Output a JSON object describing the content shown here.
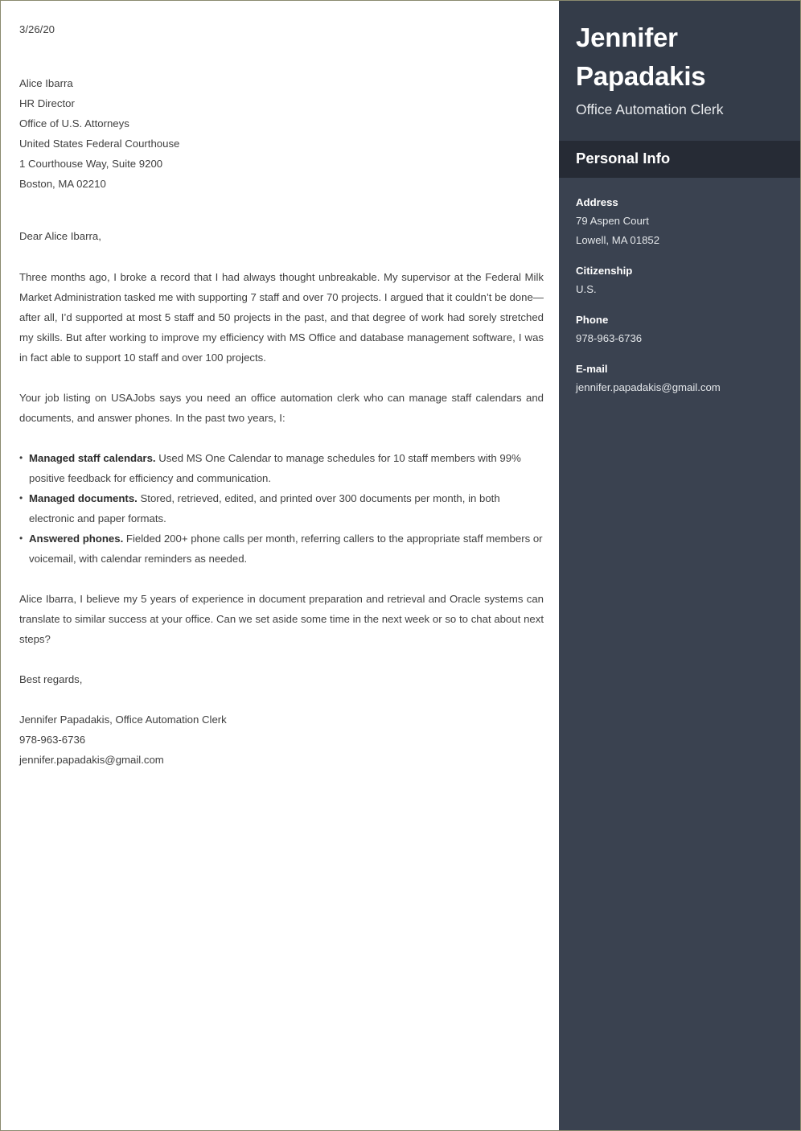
{
  "letter": {
    "date": "3/26/20",
    "recipient": [
      "Alice Ibarra",
      "HR Director",
      "Office of U.S. Attorneys",
      "United States Federal Courthouse",
      "1 Courthouse Way, Suite 9200",
      "Boston, MA 02210"
    ],
    "salutation": "Dear Alice Ibarra,",
    "paragraph1": "Three months ago, I broke a record that I had always thought unbreakable. My supervisor at the Federal Milk Market Administration tasked me with supporting 7 staff and over 70 projects. I argued that it couldn’t be done—after all, I’d supported at most 5 staff and 50 projects in the past, and that degree of work had sorely stretched my skills. But after working to improve my efficiency with MS Office and database management software, I was in fact able to support 10 staff and over 100 projects.",
    "paragraph2": "Your job listing on USAJobs says you need an office automation clerk who can manage staff calendars and documents, and answer phones. In the past two years, I:",
    "bullets": [
      {
        "lead": "Managed staff calendars.",
        "text": "Used MS One Calendar to manage schedules for 10 staff members with 99% positive feedback for efficiency and communication."
      },
      {
        "lead": "Managed documents.",
        "text": "Stored, retrieved, edited, and printed over 300 documents per month, in both electronic and paper formats."
      },
      {
        "lead": "Answered phones.",
        "text": "Fielded 200+ phone calls per month, referring callers to the appropriate staff members or voicemail, with calendar reminders as needed."
      }
    ],
    "paragraph3": "Alice Ibarra, I believe my 5 years of experience in document preparation and retrieval and Oracle systems can translate to similar success at your office. Can we set aside some time in the next week or so to chat about next steps?",
    "signoff": "Best regards,",
    "signature": [
      "Jennifer Papadakis, Office Automation Clerk",
      "978-963-6736",
      "jennifer.papadakis@gmail.com"
    ]
  },
  "sidebar": {
    "name": "Jennifer Papadakis",
    "job_title": "Office Automation Clerk",
    "section_title": "Personal Info",
    "fields": [
      {
        "label": "Address",
        "values": [
          "79 Aspen Court",
          "Lowell, MA 01852"
        ]
      },
      {
        "label": "Citizenship",
        "values": [
          "U.S."
        ]
      },
      {
        "label": "Phone",
        "values": [
          "978-963-6736"
        ]
      },
      {
        "label": "E-mail",
        "values": [
          "jennifer.papadakis@gmail.com"
        ]
      }
    ]
  },
  "colors": {
    "sidebar_background": "#3a4250",
    "sidebar_header": "#343c49",
    "section_band": "#262b35",
    "page_border": "#8a8a6e",
    "body_text": "#3f3f3f"
  }
}
